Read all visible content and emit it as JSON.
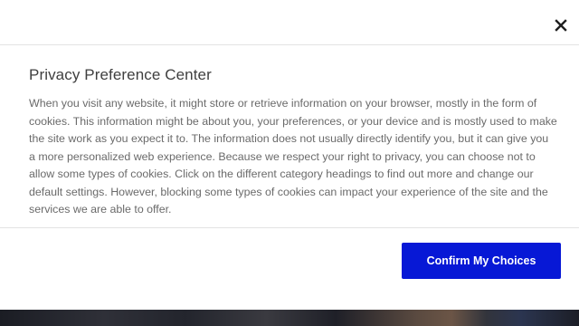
{
  "dialog": {
    "title": "Privacy Preference Center",
    "description": "When you visit any website, it might store or retrieve information on your browser, mostly in the form of cookies. This information might be about you, your preferences, or your device and is mostly used to make the site work as you expect it to. The information does not usually directly identify you, but it can give you a more personalized web experience. Because we respect your right to privacy, you can choose not to allow some types of cookies. Click on the different category headings to find out more and change our default settings. However, blocking some types of cookies can impact your experience of the site and the services we are able to offer.",
    "close_icon": "close-icon",
    "confirm_label": "Confirm My Choices"
  },
  "colors": {
    "accent": "#0718d6",
    "title": "#3f3f3f",
    "body_text": "#6a6a6a",
    "divider": "#e3e3e3"
  }
}
